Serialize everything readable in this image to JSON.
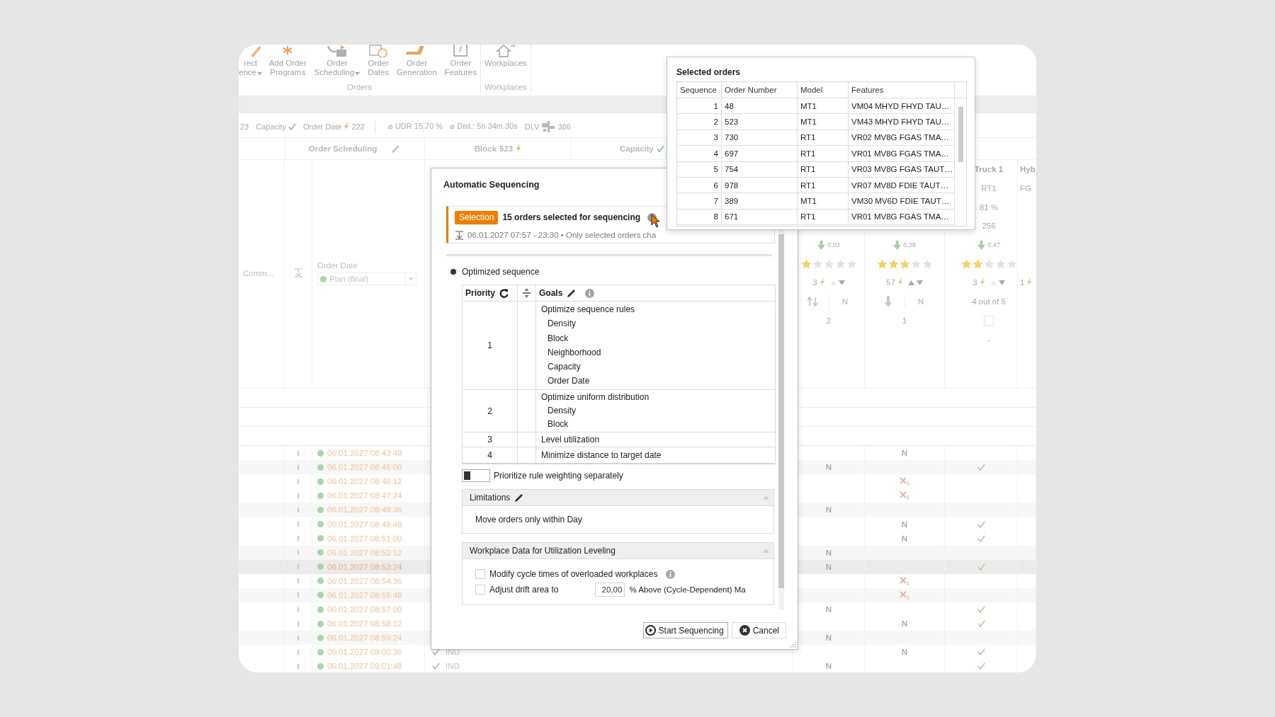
{
  "ribbon": {
    "groups": [
      {
        "label": "Orders",
        "items": [
          {
            "lines": [
              "rect",
              "ence"
            ],
            "dropdown": true
          },
          {
            "lines": [
              "Add Order",
              "Programs"
            ],
            "dropdown": false
          },
          {
            "lines": [
              "Order",
              "Scheduling"
            ],
            "dropdown": true
          },
          {
            "lines": [
              "Order",
              "Dates"
            ],
            "dropdown": false
          },
          {
            "lines": [
              "Order",
              "Generation"
            ],
            "dropdown": false
          },
          {
            "lines": [
              "Order",
              "Features"
            ],
            "dropdown": false
          }
        ]
      },
      {
        "label": "Workplaces",
        "items": [
          {
            "lines": [
              "Workplaces"
            ],
            "dropdown": false
          }
        ]
      }
    ]
  },
  "summary_bar": [
    {
      "kind": "plain",
      "text": "23"
    },
    {
      "kind": "status",
      "text": "Capacity",
      "violation": false
    },
    {
      "kind": "status",
      "text": "Order Date",
      "violation": true,
      "value": "222"
    },
    {
      "kind": "plain",
      "text": "⌀ UDR 15,70 %",
      "separator_before": true
    },
    {
      "kind": "plain",
      "text": "⌀ Dist.: 5h 34m 30s"
    },
    {
      "kind": "vehicle",
      "text": "DLV",
      "value": "386"
    }
  ],
  "column_headers": [
    {
      "kind": "editable",
      "text": "Order Scheduling"
    },
    {
      "kind": "status",
      "text": "Block",
      "value": "523",
      "violation": true
    },
    {
      "kind": "status",
      "text": "Capacity",
      "violation": false
    }
  ],
  "order_table": {
    "comment_header": "Comm...",
    "date_header": "Order Date",
    "date_filter": "Plan (final)",
    "rows": [
      {
        "date": "06.01.2027 08:43:48",
        "selected": false,
        "col_b": {
          "kind": "text",
          "text": "N"
        }
      },
      {
        "date": "06.01.2027 08:45:00",
        "selected": false,
        "col_a": {
          "kind": "text",
          "text": "N"
        },
        "col_c": {
          "kind": "check"
        }
      },
      {
        "date": "06.01.2027 08:46:12",
        "selected": false,
        "col_b": {
          "kind": "cross"
        }
      },
      {
        "date": "06.01.2027 08:47:24",
        "selected": false,
        "col_b": {
          "kind": "cross"
        }
      },
      {
        "date": "06.01.2027 08:48:36",
        "selected": false,
        "col_a": {
          "kind": "text",
          "text": "N"
        }
      },
      {
        "date": "06.01.2027 08:49:48",
        "selected": false,
        "col_b": {
          "kind": "text",
          "text": "N"
        },
        "col_c": {
          "kind": "check"
        }
      },
      {
        "date": "06.01.2027 08:51:00",
        "selected": false,
        "col_b": {
          "kind": "text",
          "text": "N"
        },
        "col_c": {
          "kind": "check"
        }
      },
      {
        "date": "06.01.2027 08:52:12",
        "selected": false,
        "col_a": {
          "kind": "text",
          "text": "N"
        }
      },
      {
        "date": "06.01.2027 08:53:24",
        "selected": true,
        "col_a": {
          "kind": "text",
          "text": "N"
        },
        "col_c": {
          "kind": "check"
        }
      },
      {
        "date": "06.01.2027 08:54:36",
        "selected": false,
        "col_b": {
          "kind": "cross"
        }
      },
      {
        "date": "06.01.2027 08:55:48",
        "selected": false,
        "col_b": {
          "kind": "cross"
        }
      },
      {
        "date": "06.01.2027 08:57:00",
        "selected": false,
        "col_a": {
          "kind": "text",
          "text": "N"
        },
        "col_c": {
          "kind": "check"
        }
      },
      {
        "date": "06.01.2027 08:58:12",
        "selected": false,
        "col_b": {
          "kind": "text",
          "text": "N"
        },
        "col_c": {
          "kind": "check"
        }
      },
      {
        "date": "06.01.2027 08:59:24",
        "selected": false,
        "col_a": {
          "kind": "text",
          "text": "N"
        }
      },
      {
        "date": "06.01.2027 09:00:36",
        "selected": false,
        "schedule": {
          "violation": false,
          "text": "IND"
        },
        "col_b": {
          "kind": "text",
          "text": "N"
        },
        "col_c": {
          "kind": "check"
        }
      },
      {
        "date": "06.01.2027 09:01:48",
        "selected": false,
        "schedule": {
          "violation": false,
          "text": "IND"
        },
        "col_a": {
          "kind": "text",
          "text": "N"
        },
        "col_c": {
          "kind": "check"
        }
      }
    ]
  },
  "workplace_columns": [
    {
      "trend": "0,03",
      "stars": 1,
      "violations": "3",
      "up_active": false,
      "down_active": true,
      "sort_up": true,
      "flag": "N",
      "count": "2"
    },
    {
      "trend": "0,38",
      "stars": 3,
      "violations": "57",
      "up_active": true,
      "down_active": true,
      "sort_up": false,
      "flag": "N",
      "count": "1"
    },
    {
      "header": "Truck 1",
      "model": "RT1",
      "share": "81 %",
      "amount": "256",
      "trend": "0,47",
      "stars": 2,
      "violations": "3",
      "up_active": false,
      "down_active": true,
      "rating": "4 out of 5",
      "checked": false,
      "note": "-"
    },
    {
      "header": "Hyb",
      "model": "FG",
      "violations": "1"
    }
  ],
  "dialog": {
    "title": "Automatic Sequencing",
    "selection": {
      "badge": "Selection",
      "summary": "15 orders selected for sequencing",
      "details": "06.01.2027 07:57 - 23:30 • Only selected orders cha"
    },
    "mode": {
      "label": "Optimized sequence",
      "selected": true
    },
    "priority_table": {
      "columns": [
        "Priority",
        "Goals"
      ],
      "rows": [
        {
          "priority": "1",
          "goal": "Optimize sequence rules",
          "children": [
            {
              "goal": "Density"
            },
            {
              "goal": "Block"
            },
            {
              "goal": "Neighborhood"
            },
            {
              "goal": "Capacity"
            },
            {
              "goal": "Order Date"
            }
          ]
        },
        {
          "priority": "2",
          "goal": "Optimize uniform distribution",
          "children": [
            {
              "goal": "Density"
            },
            {
              "goal": "Block"
            }
          ]
        },
        {
          "priority": "3",
          "goal": "Level utilization"
        },
        {
          "priority": "4",
          "goal": "Minimize distance to target date"
        }
      ]
    },
    "weighting_toggle": {
      "label": "Prioritize rule weighting separately",
      "on": false
    },
    "limitations": {
      "title": "Limitations",
      "expanded": true,
      "items": [
        "Move orders only within Day"
      ]
    },
    "workplace_data": {
      "title": "Workplace Data for Utilization Leveling",
      "expanded": true,
      "options": [
        {
          "kind": "checkbox",
          "label": "Modify cycle times of overloaded workplaces",
          "checked": false,
          "info": true
        },
        {
          "kind": "checkbox_input",
          "label": "Adjust drift area to",
          "checked": false,
          "value": "20,00",
          "unit": "% Above (Cycle-Dependent) Ma"
        }
      ]
    },
    "buttons": [
      {
        "kind": "start",
        "label": "Start Sequencing"
      },
      {
        "kind": "cancel",
        "label": "Cancel"
      }
    ]
  },
  "selected_orders": {
    "title": "Selected orders",
    "columns": [
      "Sequence",
      "Order Number",
      "Model",
      "Features"
    ],
    "rows": [
      [
        "1",
        "48",
        "MT1",
        "VM04 MHYD FHYD TAU…"
      ],
      [
        "2",
        "523",
        "MT1",
        "VM43 MHYD FHYD TAU…"
      ],
      [
        "3",
        "730",
        "RT1",
        "VR02 MV8G FGAS TMA…"
      ],
      [
        "4",
        "697",
        "RT1",
        "VR01 MV8G FGAS TMA…"
      ],
      [
        "5",
        "754",
        "RT1",
        "VR03 MV8G FGAS TAUT…"
      ],
      [
        "6",
        "978",
        "RT1",
        "VR07 MV8D FDIE TAUT…"
      ],
      [
        "7",
        "389",
        "MT1",
        "VM30 MV6D FDIE TAUT…"
      ],
      [
        "8",
        "671",
        "RT1",
        "VR01 MV8G FGAS TMA…"
      ]
    ]
  }
}
